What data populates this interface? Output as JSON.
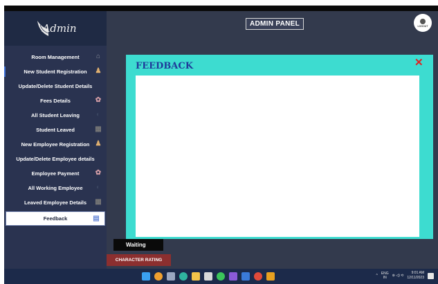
{
  "header": {
    "title": "ADMIN PANEL",
    "logout_label": "LOGOUT"
  },
  "logo": {
    "text": "Admin"
  },
  "sidebar": {
    "items": [
      {
        "label": "Room Management",
        "icon": "house-icon",
        "color": "#8a8f9c"
      },
      {
        "label": "New Student Registration",
        "icon": "student-add-icon",
        "color": "#e0b070"
      },
      {
        "label": "Update/Delete Student Details",
        "icon": "",
        "color": ""
      },
      {
        "label": "Fees  Details",
        "icon": "money-icon",
        "color": "#d8a0a8"
      },
      {
        "label": "All Student Leaving",
        "icon": "leave-icon",
        "color": "#2a3350"
      },
      {
        "label": "Student Leaved",
        "icon": "book-icon",
        "color": "#555555"
      },
      {
        "label": "New Employee Registration",
        "icon": "employee-add-icon",
        "color": "#e0b070"
      },
      {
        "label": "Update/Delete Employee details",
        "icon": "",
        "color": ""
      },
      {
        "label": "Employee Payment",
        "icon": "payment-icon",
        "color": "#d8a0a8"
      },
      {
        "label": "All Working Employee",
        "icon": "worker-icon",
        "color": "#2a3350"
      },
      {
        "label": "Leaved Employee Details",
        "icon": "book-icon",
        "color": "#555555"
      },
      {
        "label": "Feedback",
        "icon": "feedback-icon",
        "color": "#6a8ad8"
      }
    ]
  },
  "feedback": {
    "title": "FEEDBACK",
    "close_symbol": "✕",
    "text_value": ""
  },
  "status": {
    "waiting_label": "Waiting",
    "rating_button_label": "CHARACTER RATING"
  },
  "taskbar": {
    "lang_top": "ENG",
    "lang_bottom": "IN",
    "time": "9:01 AM",
    "date": "12/11/2023",
    "tray_caret": "^",
    "tray_icons": "⊚ ◁) ⟲"
  },
  "colors": {
    "sidebar_bg": "#2a3350",
    "main_bg": "#333a4d",
    "panel_accent": "#3ddcd0",
    "title_blue": "#1f3b9a",
    "close_red": "#e02020",
    "rating_button": "#8c2f2f",
    "taskbar_bg": "#1c2a4a"
  }
}
